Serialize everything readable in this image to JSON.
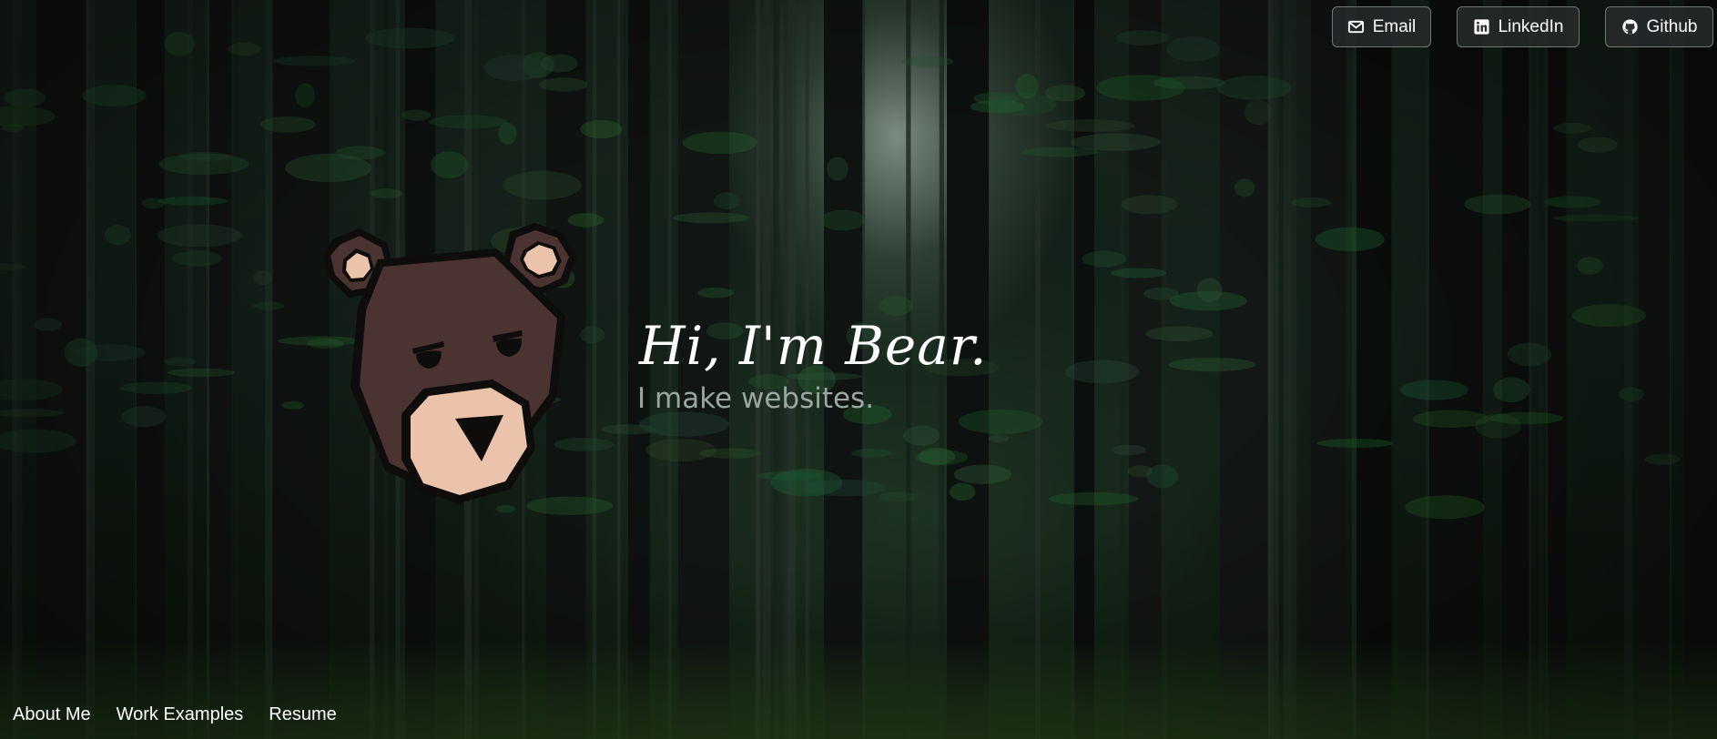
{
  "header": {
    "social_links": [
      {
        "label": "Email",
        "icon": "envelope-icon"
      },
      {
        "label": "LinkedIn",
        "icon": "linkedin-icon"
      },
      {
        "label": "Github",
        "icon": "github-icon"
      }
    ]
  },
  "hero": {
    "headline": "Hi, I'm Bear.",
    "tagline": "I make websites.",
    "background_image": "dark pine forest",
    "logo": "bear-face-logo"
  },
  "footer_nav": {
    "items": [
      {
        "label": "About Me"
      },
      {
        "label": "Work Examples"
      },
      {
        "label": "Resume"
      }
    ]
  },
  "colors": {
    "bear_fur": "#4a3331",
    "bear_muzzle": "#ebc3aa",
    "bear_outline": "#0e0d0c",
    "button_bg": "#2b2f2e",
    "button_border": "#6f7774",
    "headline_text": "#ffffff",
    "tagline_text": "#9aa6a0"
  }
}
